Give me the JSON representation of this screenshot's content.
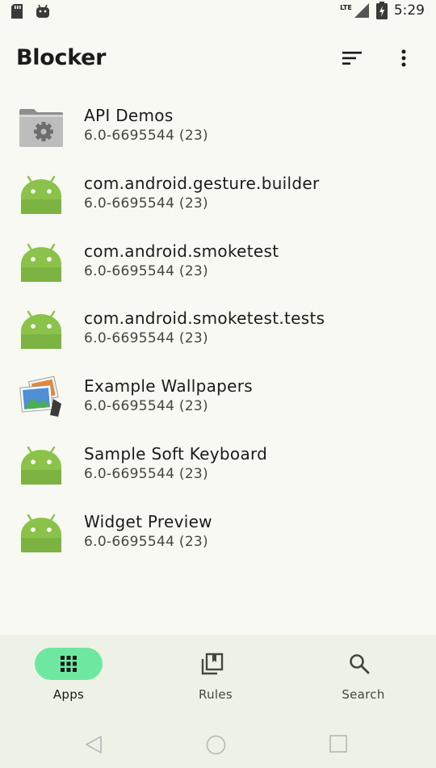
{
  "status_bar": {
    "time": "5:29",
    "network": "LTE",
    "icons": [
      "sd-card-icon",
      "android-debug-icon",
      "signal-icon",
      "battery-icon"
    ]
  },
  "app_bar": {
    "title": "Blocker",
    "actions": [
      "sort-icon",
      "more-vert-icon"
    ]
  },
  "apps": [
    {
      "name": "API Demos",
      "version": "6.0-6695544 (23)",
      "icon": "api-demos-gear-folder-icon"
    },
    {
      "name": "com.android.gesture.builder",
      "version": "6.0-6695544 (23)",
      "icon": "android-robot-icon"
    },
    {
      "name": "com.android.smoketest",
      "version": "6.0-6695544 (23)",
      "icon": "android-robot-icon"
    },
    {
      "name": "com.android.smoketest.tests",
      "version": "6.0-6695544 (23)",
      "icon": "android-robot-icon"
    },
    {
      "name": "Example Wallpapers",
      "version": "6.0-6695544 (23)",
      "icon": "wallpapers-photos-icon"
    },
    {
      "name": "Sample Soft Keyboard",
      "version": "6.0-6695544 (23)",
      "icon": "android-robot-icon"
    },
    {
      "name": "Widget Preview",
      "version": "6.0-6695544 (23)",
      "icon": "android-robot-icon"
    }
  ],
  "bottom_nav": {
    "items": [
      {
        "label": "Apps",
        "icon": "apps-grid-icon",
        "selected": true
      },
      {
        "label": "Rules",
        "icon": "rules-bookmark-icon",
        "selected": false
      },
      {
        "label": "Search",
        "icon": "search-icon",
        "selected": false
      }
    ]
  },
  "colors": {
    "background": "#f7f9f2",
    "nav_background": "#eef2e6",
    "selected_pill": "#6ee8a0",
    "android_green": "#8bc34a"
  }
}
